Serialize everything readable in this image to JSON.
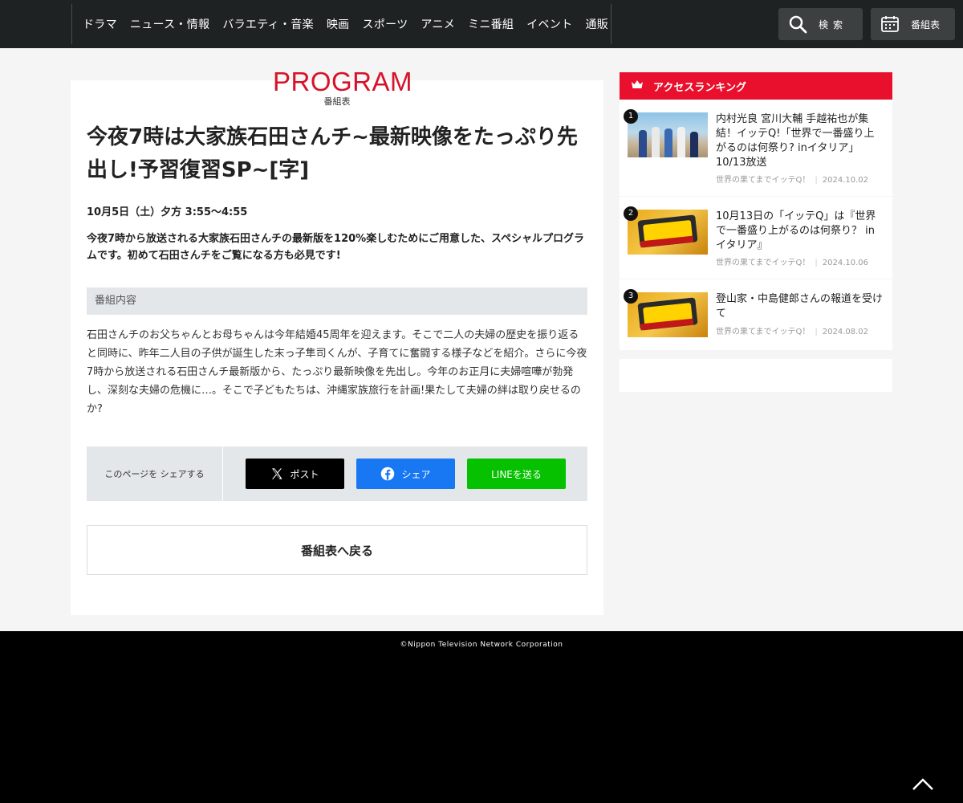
{
  "header": {
    "nav": [
      "ドラマ",
      "ニュース・情報",
      "バラエティ・音楽",
      "映画",
      "スポーツ",
      "アニメ",
      "ミニ番組",
      "イベント",
      "通販"
    ],
    "search_label": "検索",
    "schedule_label": "番組表"
  },
  "section": {
    "title_en": "PROGRAM",
    "title_ja": "番組表"
  },
  "program": {
    "title": "今夜7時は大家族石田さんチ~最新映像をたっぷり先出し!予習復習SP~[字]",
    "airdate": "10月5日（土）夕方 3:55〜4:55",
    "lead": "今夜7時から放送される大家族石田さんチの最新版を120%楽しむためにご用意した、スペシャルプログラムです。初めて石田さんチをご覧になる方も必見です!",
    "content_heading": "番組内容",
    "content": "石田さんチのお父ちゃんとお母ちゃんは今年結婚45周年を迎えます。そこで二人の夫婦の歴史を振り返ると同時に、昨年二人目の子供が誕生した末っ子隼司くんが、子育てに奮闘する様子などを紹介。さらに今夜7時から放送される石田さんチ最新版から、たっぷり最新映像を先出し。今年のお正月に夫婦喧嘩が勃発し、深刻な夫婦の危機に…。そこで子どもたちは、沖縄家族旅行を計画!果たして夫婦の絆は取り戻せるのか?"
  },
  "share": {
    "label": "このページを シェアする",
    "x_label": "ポスト",
    "facebook_label": "シェア",
    "line_label": "LINEを送る"
  },
  "back_label": "番組表へ戻る",
  "ranking": {
    "heading": "アクセスランキング",
    "items": [
      {
        "rank": "1",
        "title": "内村光良 宮川大輔 手越祐也が集結！イッテQ!「世界で一番盛り上がるのは何祭り? inイタリア」10/13放送",
        "program": "世界の果てまでイッテQ！",
        "date": "2024.10.02"
      },
      {
        "rank": "2",
        "title": "10月13日の「イッテQ」は『世界で一番盛り上がるのは何祭り？ in イタリア』",
        "program": "世界の果てまでイッテQ！",
        "date": "2024.10.06"
      },
      {
        "rank": "3",
        "title": "登山家・中島健郎さんの報道を受けて",
        "program": "世界の果てまでイッテQ！",
        "date": "2024.08.02"
      }
    ]
  },
  "footer": {
    "copyright": "©Nippon Television Network Corporation"
  },
  "colors": {
    "accent_red": "#e8102c",
    "header_bg": "#1f2222",
    "x_black": "#000000",
    "facebook_blue": "#1877f2",
    "line_green": "#06c100"
  }
}
